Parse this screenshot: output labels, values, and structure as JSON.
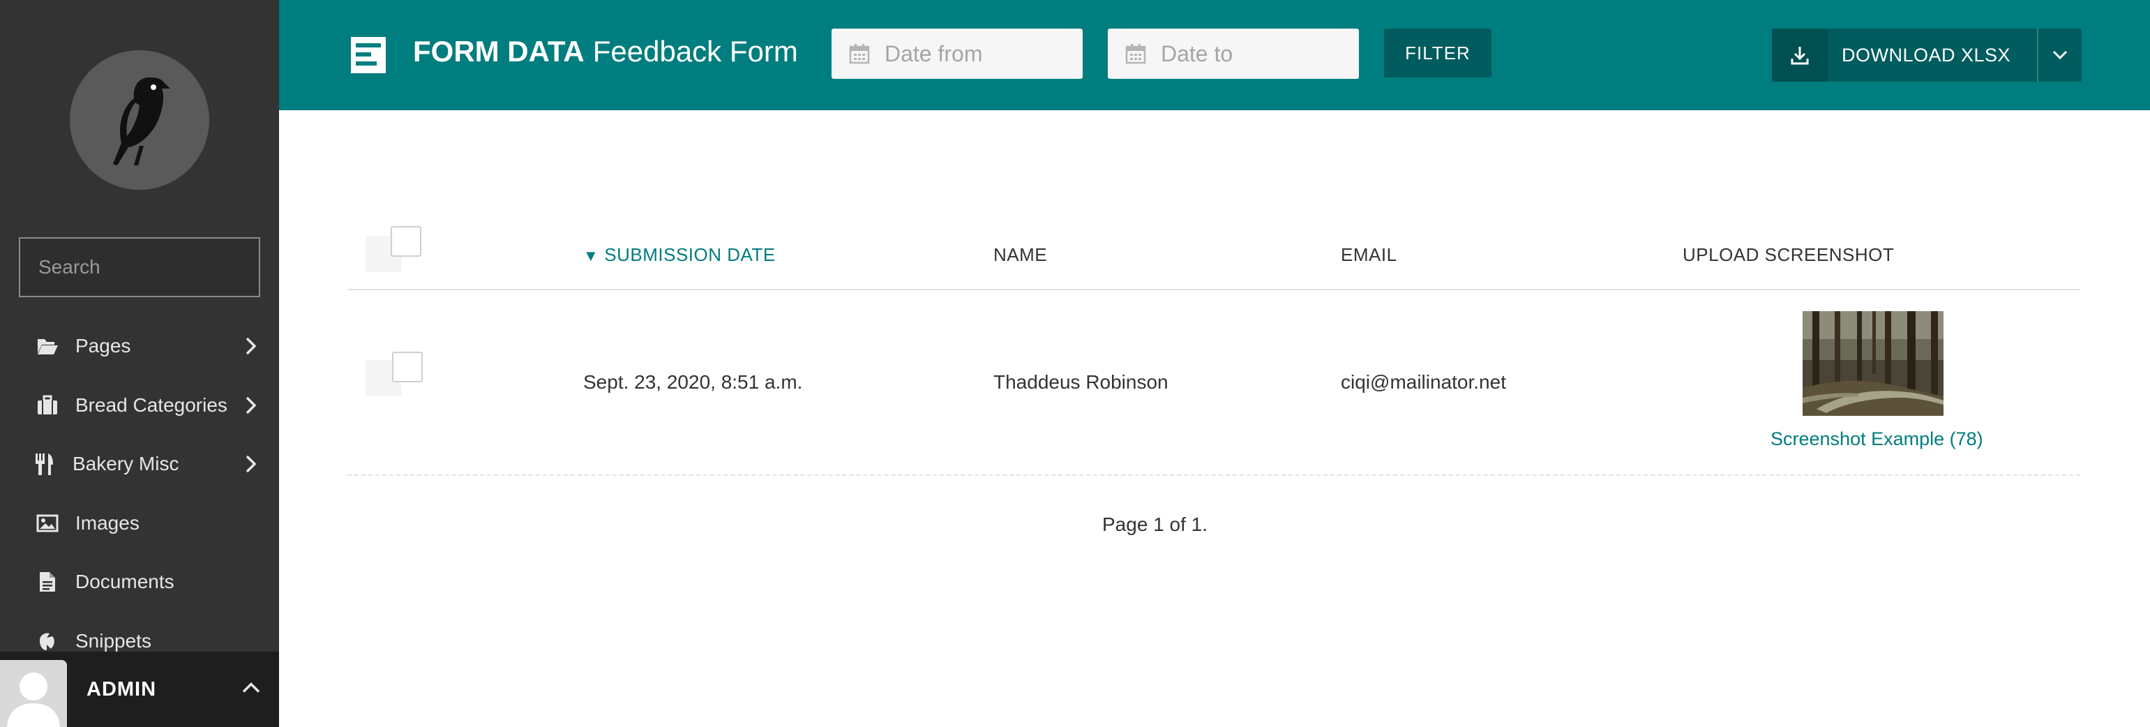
{
  "sidebar": {
    "search": {
      "placeholder": "Search",
      "value": ""
    },
    "menu": [
      {
        "label": "Pages",
        "icon": "folder-open-icon",
        "has_children": true
      },
      {
        "label": "Bread Categories",
        "icon": "suitcase-icon",
        "has_children": true
      },
      {
        "label": "Bakery Misc",
        "icon": "utensils-icon",
        "has_children": true
      },
      {
        "label": "Images",
        "icon": "image-icon",
        "has_children": false
      },
      {
        "label": "Documents",
        "icon": "document-icon",
        "has_children": false
      },
      {
        "label": "Snippets",
        "icon": "snippet-icon",
        "has_children": false
      }
    ],
    "account": {
      "name": "ADMIN"
    }
  },
  "header": {
    "title_strong": "FORM DATA",
    "title_light": "Feedback Form",
    "date_from_placeholder": "Date from",
    "date_to_placeholder": "Date to",
    "filter_label": "FILTER",
    "download_label": "DOWNLOAD XLSX"
  },
  "table": {
    "columns": {
      "submission_date": "SUBMISSION DATE",
      "name": "NAME",
      "email": "EMAIL",
      "upload_screenshot": "UPLOAD SCREENSHOT"
    },
    "sort_indicator": "▼",
    "rows": [
      {
        "submission_date": "Sept. 23, 2020, 8:51 a.m.",
        "name": "Thaddeus Robinson",
        "email": "ciqi@mailinator.net",
        "screenshot_title": "Screenshot Example (78)"
      }
    ]
  },
  "pagination": {
    "text": "Page 1 of 1."
  },
  "colors": {
    "teal": "#007d7e",
    "teal_dark": "#005c5e",
    "sidebar_bg": "#333333"
  }
}
